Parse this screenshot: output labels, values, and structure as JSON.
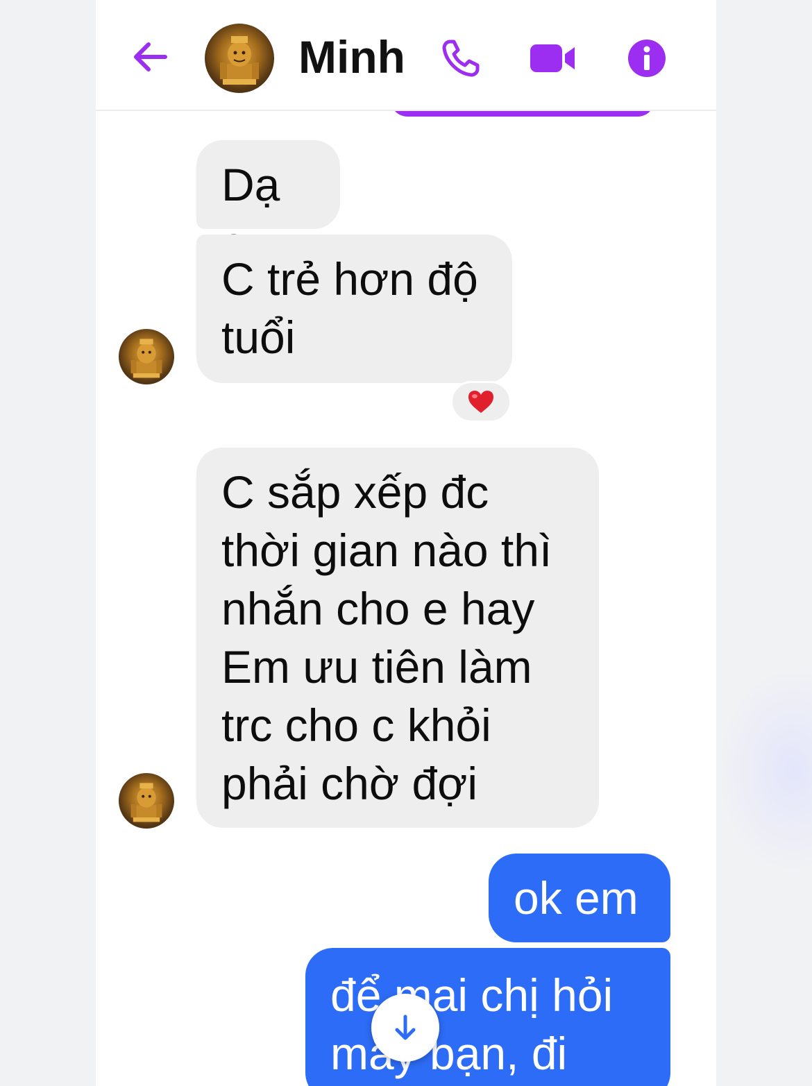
{
  "header": {
    "contact_name": "Minh",
    "accent_color": "#9b2ef0",
    "icons": [
      "back-arrow-icon",
      "phone-icon",
      "video-camera-icon",
      "info-icon"
    ]
  },
  "messages": [
    {
      "direction": "incoming",
      "text_lines": [
        "Dạ c"
      ]
    },
    {
      "direction": "incoming",
      "text_lines": [
        "C trẻ hơn độ",
        "tuổi"
      ],
      "reaction": "❤️"
    },
    {
      "direction": "incoming",
      "text_lines": [
        "C sắp xếp đc",
        "thời gian nào thì",
        "nhắn cho e hay",
        "Em ưu tiên làm",
        "trc cho c khỏi",
        "phải chờ đợi"
      ]
    },
    {
      "direction": "outgoing",
      "text_lines": [
        "ok em"
      ]
    },
    {
      "direction": "outgoing",
      "text_lines": [
        "để mai chị hỏi",
        "mấy bạn, đi"
      ]
    }
  ],
  "colors": {
    "incoming_bubble": "#eeeeef",
    "outgoing_bubble": "#2d6cf6"
  },
  "scroll_down_icon": "arrow-down-icon"
}
